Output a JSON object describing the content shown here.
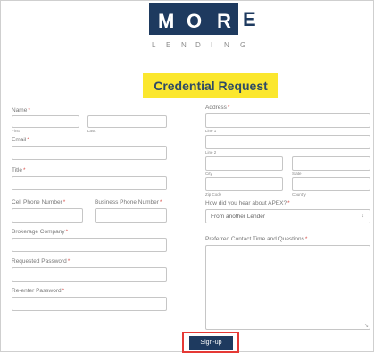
{
  "logo": {
    "letters": [
      "M",
      "O",
      "R",
      "E"
    ],
    "subtitle_letters": [
      "L",
      "E",
      "N",
      "D",
      "I",
      "N",
      "G"
    ]
  },
  "title": "Credential Request",
  "form": {
    "name": {
      "label": "Name",
      "first": "First",
      "last": "Last"
    },
    "email": {
      "label": "Email"
    },
    "title_field": {
      "label": "Title"
    },
    "cell_phone": {
      "label": "Cell Phone Number"
    },
    "business_phone": {
      "label": "Business Phone Number"
    },
    "brokerage": {
      "label": "Brokerage Company"
    },
    "password": {
      "label": "Requested Password"
    },
    "password_confirm": {
      "label": "Re-enter Password"
    },
    "address": {
      "label": "Address",
      "line1": "Line 1",
      "line2": "Line 2",
      "city": "City",
      "state": "State",
      "zip": "Zip Code",
      "country": "Country"
    },
    "heard": {
      "label": "How did you hear about APEX?",
      "value": "From another Lender"
    },
    "contact_time": {
      "label": "Preferred Contact Time and Questions"
    },
    "required_mark": "*"
  },
  "submit": {
    "label": "Sign-up"
  },
  "colors": {
    "brand": "#1e3a5f",
    "highlight": "#fbe72e",
    "outline": "#e53935"
  }
}
